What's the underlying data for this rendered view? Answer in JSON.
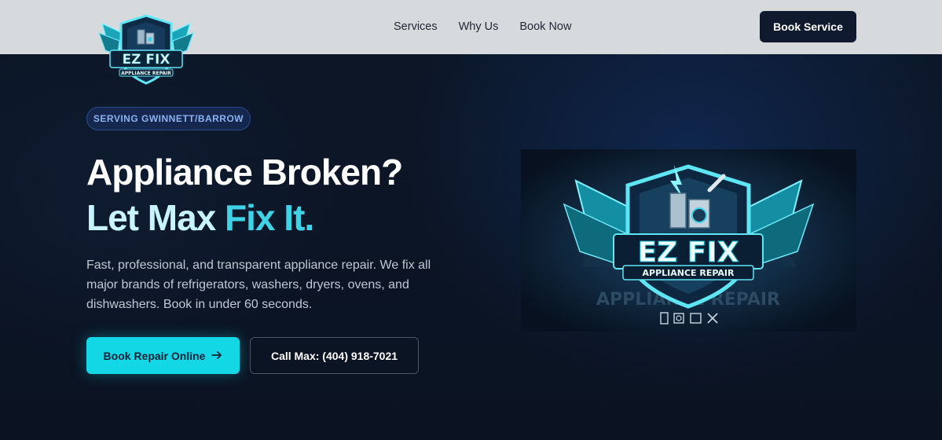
{
  "nav": {
    "logo_title": "EZ FIX",
    "logo_subtitle": "APPLIANCE REPAIR",
    "links": [
      "Services",
      "Why Us",
      "Book Now"
    ],
    "cta_label": "Book Service"
  },
  "hero": {
    "badge": "SERVING GWINNETT/BARROW",
    "headline_line1": "Appliance Broken?",
    "headline_part_a": "Let Max ",
    "headline_part_b": "Fix It.",
    "description": "Fast, professional, and transparent appliance repair. We fix all major brands of refrigerators, washers, dryers, ovens, and dishwashers. Book in under 60 seconds.",
    "primary_button": "Book Repair Online",
    "secondary_button": "Call Max: (404) 918-7021",
    "image_title": "EZ FIX",
    "image_subtitle": "APPLIANCE REPAIR",
    "image_backdrop_text": "APPLIANCE REPAIR"
  },
  "colors": {
    "accent": "#14d7e6",
    "navy": "#0f1a2e",
    "headline_accent": "#3fd3e8"
  }
}
